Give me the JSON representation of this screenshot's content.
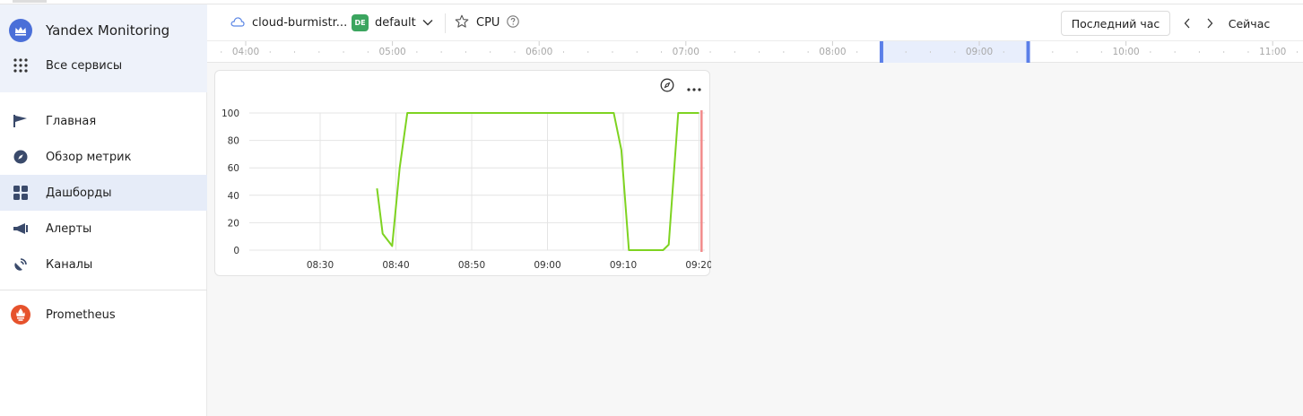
{
  "sidebar": {
    "brand": "Yandex Monitoring",
    "all_services": "Все сервисы",
    "items": [
      {
        "label": "Главная",
        "icon": "flag-icon"
      },
      {
        "label": "Обзор метрик",
        "icon": "compass-icon"
      },
      {
        "label": "Дашборды",
        "icon": "dashboard-icon"
      },
      {
        "label": "Алерты",
        "icon": "megaphone-icon"
      },
      {
        "label": "Каналы",
        "icon": "satellite-icon"
      }
    ],
    "prometheus": "Prometheus",
    "active_item": "Дашборды"
  },
  "header": {
    "cloud": "cloud-burmistr...",
    "folder_badge": "DE",
    "folder": "default",
    "dashboard": "CPU",
    "period_button": "Последний час",
    "now_button": "Сейчас"
  },
  "timeline": {
    "labels": [
      "04:00",
      "05:00",
      "06:00",
      "07:00",
      "08:00",
      "09:00",
      "10:00",
      "11:00"
    ],
    "selection": {
      "start": "08:20",
      "end": "09:20"
    }
  },
  "chart_data": {
    "type": "line",
    "title": "",
    "xlabel": "",
    "ylabel": "",
    "ylim": [
      0,
      100
    ],
    "yticks": [
      "0",
      "20",
      "40",
      "60",
      "80",
      "100"
    ],
    "xticks": [
      "08:30",
      "08:40",
      "08:50",
      "09:00",
      "09:10",
      "09:20"
    ],
    "series": [
      {
        "color": "#7ed321",
        "x": [
          "08:37:30",
          "08:38:15",
          "08:39:30",
          "08:40:30",
          "08:41:30",
          "09:08:45",
          "09:09:45",
          "09:10:45",
          "09:15:15",
          "09:16:00",
          "09:17:15",
          "09:20:00"
        ],
        "y": [
          45,
          12,
          3,
          60,
          100,
          100,
          73,
          0,
          0,
          4,
          100,
          100
        ]
      }
    ],
    "now_marker": {
      "x": "09:20:20",
      "color": "#f28b8b"
    },
    "grid": true
  }
}
